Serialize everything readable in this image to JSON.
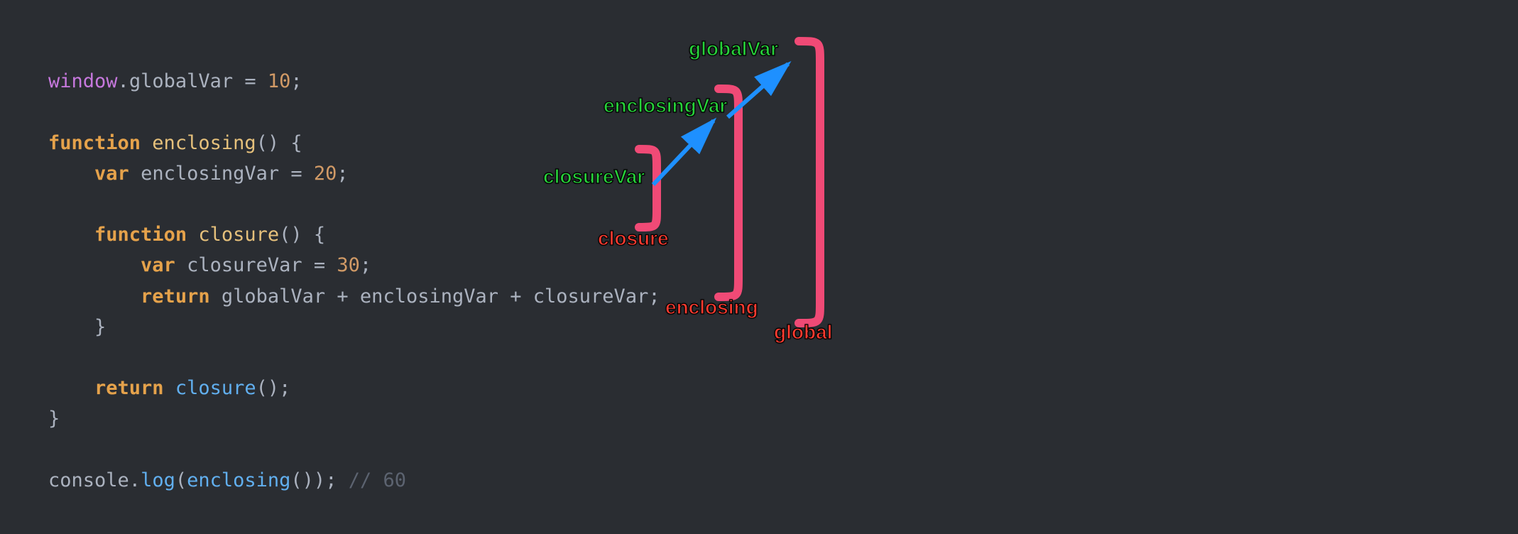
{
  "code": {
    "l1_window": "window",
    "l1_dot": ".",
    "l1_prop": "globalVar",
    "l1_eq": " = ",
    "l1_num": "10",
    "l1_semi": ";",
    "l3_function": "function",
    "l3_name": " enclosing",
    "l3_paren": "() {",
    "l4_indent": "    ",
    "l4_var": "var",
    "l4_name": " enclosingVar = ",
    "l4_num": "20",
    "l4_semi": ";",
    "l6_indent": "    ",
    "l6_function": "function",
    "l6_name": " closure",
    "l6_paren": "() {",
    "l7_indent": "        ",
    "l7_var": "var",
    "l7_name": " closureVar = ",
    "l7_num": "30",
    "l7_semi": ";",
    "l8_indent": "        ",
    "l8_return": "return",
    "l8_expr_a": " globalVar ",
    "l8_plus1": "+",
    "l8_expr_b": " enclosingVar ",
    "l8_plus2": "+",
    "l8_expr_c": " closureVar",
    "l8_semi": ";",
    "l9_indent": "    ",
    "l9_close": "}",
    "l11_indent": "    ",
    "l11_return": "return",
    "l11_call": " closure",
    "l11_paren": "();",
    "l12_close": "}",
    "l14_console": "console",
    "l14_dot": ".",
    "l14_log": "log",
    "l14_open": "(",
    "l14_enclosing": "enclosing",
    "l14_close": "());",
    "l14_comment": " // 60"
  },
  "labels": {
    "globalVar": "globalVar",
    "enclosingVar": "enclosingVar",
    "closureVar": "closureVar",
    "closure": "closure",
    "enclosing": "enclosing",
    "global": "global"
  },
  "colors": {
    "bracket": "#f04a76",
    "arrow": "#1e90ff"
  }
}
